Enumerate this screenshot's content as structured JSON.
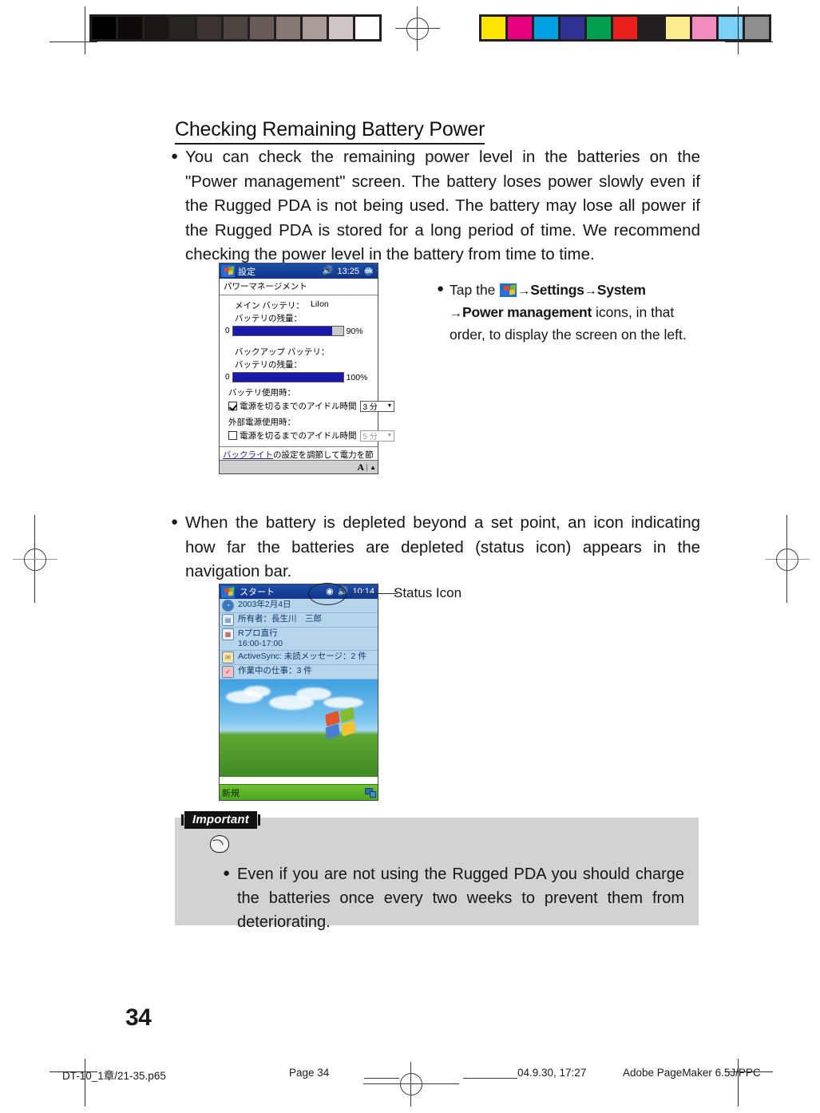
{
  "page": {
    "number": "34",
    "heading": "Checking Remaining Battery Power"
  },
  "paragraphs": {
    "first": "You can check the remaining power level in the batteries on the \"Power management\" screen. The battery loses power slowly even if the Rugged PDA is not being used. The battery may lose all power if the Rugged PDA is stored for a long period of time. We recommend checking the power level in the battery from time to time.",
    "second": "When the battery is depleted beyond a set point, an icon indicating how far the batteries are depleted (status icon) appears in the navigation bar."
  },
  "tap_note": {
    "prefix": "Tap the",
    "arrow": "→",
    "settings": "Settings",
    "system": "System",
    "power_management": "Power management",
    "suffix": "icons, in that order, to display the screen on the left."
  },
  "callout": {
    "status_icon_label": "Status Icon"
  },
  "settings_screen": {
    "title": "設定",
    "time": "13:25",
    "ok_label": "ok",
    "subtitle": "パワーマネージメント",
    "main_battery_label": "メイン バッテリ：",
    "main_battery_type": "LiIon",
    "main_remaining_label": "バッテリの残量：",
    "main_gauge_zero": "0",
    "main_gauge_percent": "90%",
    "main_gauge_value": 90,
    "backup_battery_label": "バックアップ バッテリ：",
    "backup_remaining_label": "バッテリの残量：",
    "backup_gauge_zero": "0",
    "backup_gauge_percent": "100%",
    "backup_gauge_value": 100,
    "battery_mode_label": "バッテリ使用時：",
    "battery_idle_label": "電源を切るまでのアイドル時間",
    "battery_idle_value": "3 分",
    "external_mode_label": "外部電源使用時：",
    "external_idle_label": "電源を切るまでのアイドル時間",
    "external_idle_value": "5 分",
    "link_text": "バックライト",
    "link_rest": "の設定を調節して電力を節約します。",
    "sip_letter": "A",
    "sip_caret": "▲"
  },
  "today_screen": {
    "start_label": "スタート",
    "time": "10:14",
    "rows": [
      {
        "icon": "clock-icon",
        "text": "2003年2月4日",
        "second": ""
      },
      {
        "icon": "owner-card-icon",
        "text": "所有者：長生川　三郎",
        "second": ""
      },
      {
        "icon": "calendar-icon",
        "text": "Rプロ直行",
        "second": "16:00-17:00"
      },
      {
        "icon": "mail-icon",
        "text": "ActiveSync: 未読メッセージ：2 件",
        "second": ""
      },
      {
        "icon": "tasks-icon",
        "text": "作業中の仕事：3 件",
        "second": ""
      }
    ],
    "taskbar_label": "新規"
  },
  "important": {
    "tag": "Important",
    "text": "Even if you are not using the Rugged PDA you should charge the batteries once every two weeks to prevent them from deteriorating."
  },
  "footer": {
    "file": "DT-10_1章/21-35.p65",
    "page": "Page 34",
    "date": "04.9.30, 17:27",
    "app": "Adobe PageMaker 6.5J/PPC"
  },
  "calibration": {
    "grayscale": [
      "#000000",
      "#0d0a09",
      "#1b1614",
      "#2a2421",
      "#3b332f",
      "#4d443f",
      "#675c57",
      "#857873",
      "#a79c98",
      "#d0c7c4",
      "#ffffff"
    ],
    "colors": [
      "#ffe400",
      "#e6007e",
      "#00a0e2",
      "#2e3192",
      "#00a050",
      "#e8201c",
      "#231f20",
      "#fbed8f",
      "#f48cc0",
      "#7ad0f5",
      "#8e8e8e"
    ]
  }
}
